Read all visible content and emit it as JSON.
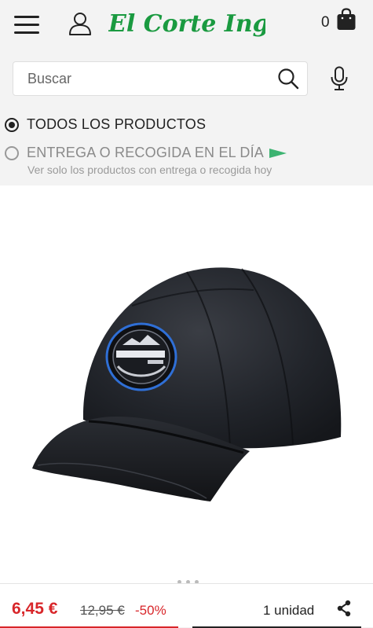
{
  "header": {
    "logo_text": "El Corte Inglés",
    "cart_count": "0",
    "menu_icon": "hamburger-menu-icon",
    "user_icon": "user-icon",
    "bag_icon": "shopping-bag-icon"
  },
  "search": {
    "placeholder": "Buscar",
    "value": "",
    "search_icon": "magnifier-icon",
    "mic_icon": "microphone-icon"
  },
  "filters": {
    "options": [
      {
        "label": "TODOS LOS PRODUCTOS",
        "selected": true
      },
      {
        "label": "ENTREGA O RECOGIDA EN EL DÍA",
        "selected": false,
        "subtext": "Ver solo los productos con entrega o recogida hoy"
      }
    ],
    "flag_color": "#3cb371"
  },
  "product": {
    "image_alt": "Gorra negra",
    "carousel_pages": 3
  },
  "purchase_bar": {
    "price": "6,45 €",
    "old_price": "12,95 €",
    "discount": "-50%",
    "quantity": "1 unidad",
    "share_icon": "share-icon"
  },
  "colors": {
    "brand_green": "#1a9a40",
    "price_red": "#d8262a"
  }
}
